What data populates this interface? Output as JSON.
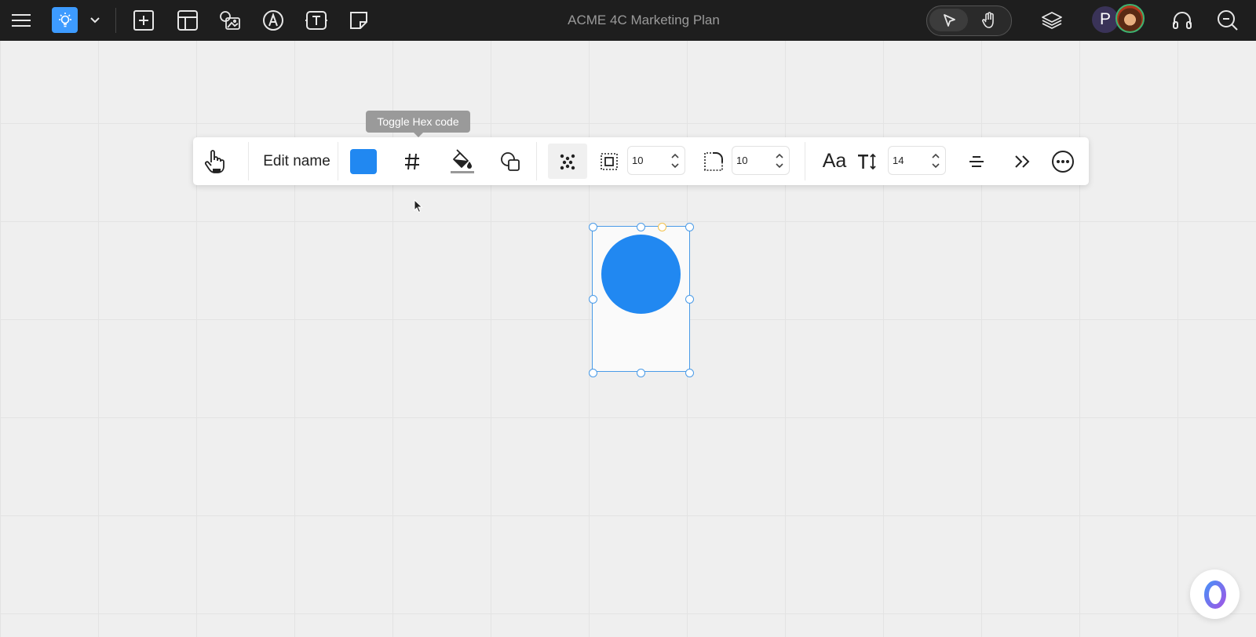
{
  "app": {
    "document_title": "ACME 4C Marketing Plan"
  },
  "topbar": {
    "left_icons": [
      "menu-icon",
      "lightbulb-icon",
      "chevron-down-icon",
      "add-frame-icon",
      "template-icon",
      "image-icon",
      "pen-icon",
      "text-icon",
      "sticky-note-icon"
    ],
    "mode_toggle": {
      "options": [
        "select",
        "pan"
      ],
      "active": "select"
    },
    "right_icons": [
      "layers-icon",
      "headset-icon",
      "search-comments-icon"
    ],
    "avatar_initial": "P"
  },
  "tooltip": {
    "text": "Toggle Hex code"
  },
  "toolbar": {
    "edit_name_label": "Edit name",
    "fill_color": "#2188f1",
    "padding_value": "10",
    "corner_radius_value": "10",
    "font_size_value": "14",
    "font_label": "Aa",
    "text_size_label": "TI"
  },
  "canvas": {
    "shape_fill": "#fafafa",
    "circle_fill": "#2188f1",
    "selection_color": "#4a9be8"
  },
  "colors": {
    "topbar_bg": "#1e1e1e",
    "accent_blue": "#3d9bff",
    "canvas_bg": "#efefef"
  }
}
